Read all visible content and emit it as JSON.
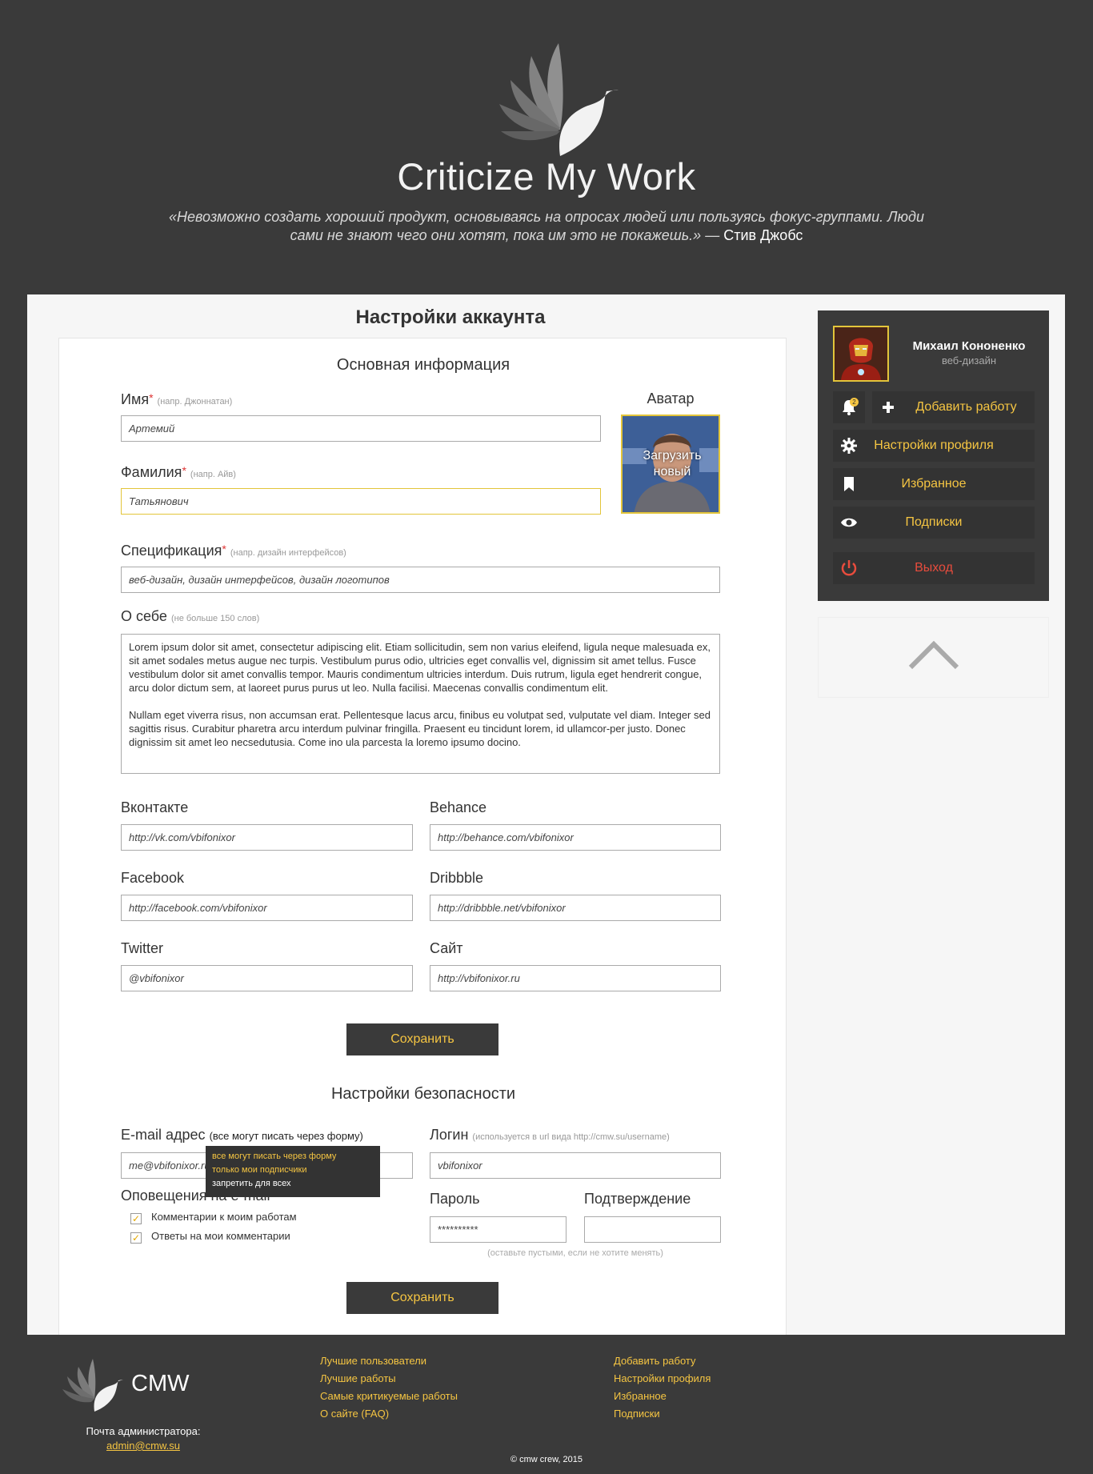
{
  "header": {
    "site_title": "Criticize My Work",
    "quote": "«Невозможно создать хороший продукт, основываясь на опросах людей или пользуясь фокус-группами. Люди сами не знают чего они хотят, пока им это не покажешь.» —",
    "quote_author": "Стив Джобс"
  },
  "page": {
    "title": "Настройки аккаунта"
  },
  "basic": {
    "section_title": "Основная информация",
    "first_name": {
      "label": "Имя",
      "required": "*",
      "hint": "(напр. Джоннатан)",
      "value": "Артемий"
    },
    "last_name": {
      "label": "Фамилия",
      "required": "*",
      "hint": "(напр. Айв)",
      "value": "Татьянович"
    },
    "avatar": {
      "label": "Аватар",
      "upload": "Загрузить новый"
    },
    "spec": {
      "label": "Спецификация",
      "required": "*",
      "hint": "(напр. дизайн интерфейсов)",
      "value": "веб-дизайн, дизайн интерфейсов, дизайн логотипов"
    },
    "about": {
      "label": "О себе",
      "hint": "(не больше 150 слов)",
      "p1": "Lorem ipsum dolor sit amet, consectetur adipiscing elit. Etiam sollicitudin, sem non varius eleifend, ligula neque malesuada ex, sit amet sodales metus augue nec turpis. Vestibulum purus odio, ultricies eget convallis vel, dignissim sit amet tellus. Fusce vestibulum dolor sit amet convallis tempor. Mauris condimentum ultricies interdum. Duis rutrum, ligula eget hendrerit congue, arcu dolor dictum sem, at laoreet purus purus ut leo. Nulla facilisi. Maecenas convallis condimentum elit.",
      "p2": "Nullam eget viverra risus, non accumsan erat. Pellentesque lacus arcu, finibus eu volutpat sed, vulputate vel diam. Integer sed sagittis risus. Curabitur pharetra arcu interdum pulvinar fringilla. Praesent eu tincidunt lorem, id ullamcor-per justo. Donec dignissim sit amet leo necsedutusia. Come ino ula parcesta la loremo ipsumo docino."
    },
    "vk": {
      "label": "Вконтакте",
      "value": "http://vk.com/vbifonixor"
    },
    "behance": {
      "label": "Behance",
      "value": "http://behance.com/vbifonixor"
    },
    "facebook": {
      "label": "Facebook",
      "value": "http://facebook.com/vbifonixor"
    },
    "dribbble": {
      "label": "Dribbble",
      "value": "http://dribbble.net/vbifonixor"
    },
    "twitter": {
      "label": "Twitter",
      "value": "@vbifonixor"
    },
    "site": {
      "label": "Сайт",
      "value": "http://vbifonixor.ru"
    },
    "save": "Сохранить"
  },
  "security": {
    "section_title": "Настройки безопасности",
    "email": {
      "label": "E-mail адрес",
      "visibility": "(все могут писать через форму)",
      "value": "me@vbifonixor.ru"
    },
    "visibility_options": [
      "все могут писать через форму",
      "только мои подписчики",
      "запретить для всех"
    ],
    "login": {
      "label": "Логин",
      "hint": "(используется в url вида http://cmw.su/username)",
      "value": "vbifonixor"
    },
    "notifications": {
      "label": "Оповещения на e-mail",
      "item1": "Комментарии к моим работам",
      "item2": "Ответы на мои комментарии"
    },
    "password": {
      "label": "Пароль",
      "value": "**********"
    },
    "confirm": {
      "label": "Подтверждение",
      "value": ""
    },
    "password_note": "(оставьте пустыми, если не хотите менять)",
    "save": "Сохранить"
  },
  "sidebar": {
    "user_name": "Михаил Кононенко",
    "user_role": "веб-дизайн",
    "notification_count": "2",
    "items": [
      {
        "label": "Добавить работу",
        "icon": "plus-icon"
      },
      {
        "label": "Настройки профиля",
        "icon": "gear-icon"
      },
      {
        "label": "Избранное",
        "icon": "bookmark-icon"
      },
      {
        "label": "Подписки",
        "icon": "eye-icon"
      },
      {
        "label": "Выход",
        "icon": "power-icon"
      }
    ]
  },
  "footer": {
    "brand": "CMW",
    "admin_label": "Почта администратора:",
    "admin_email": "admin@cmw.su",
    "col1": [
      "Лучшие пользователи",
      "Лучшие работы",
      "Самые критикуемые работы",
      "О сайте (FAQ)"
    ],
    "col2": [
      "Добавить работу",
      "Настройки профиля",
      "Избранное",
      "Подписки"
    ],
    "copyright": "© cmw crew, 2015"
  },
  "colors": {
    "accent": "#f5c542",
    "dark": "#3a3a3a",
    "danger": "#e84c3d"
  }
}
